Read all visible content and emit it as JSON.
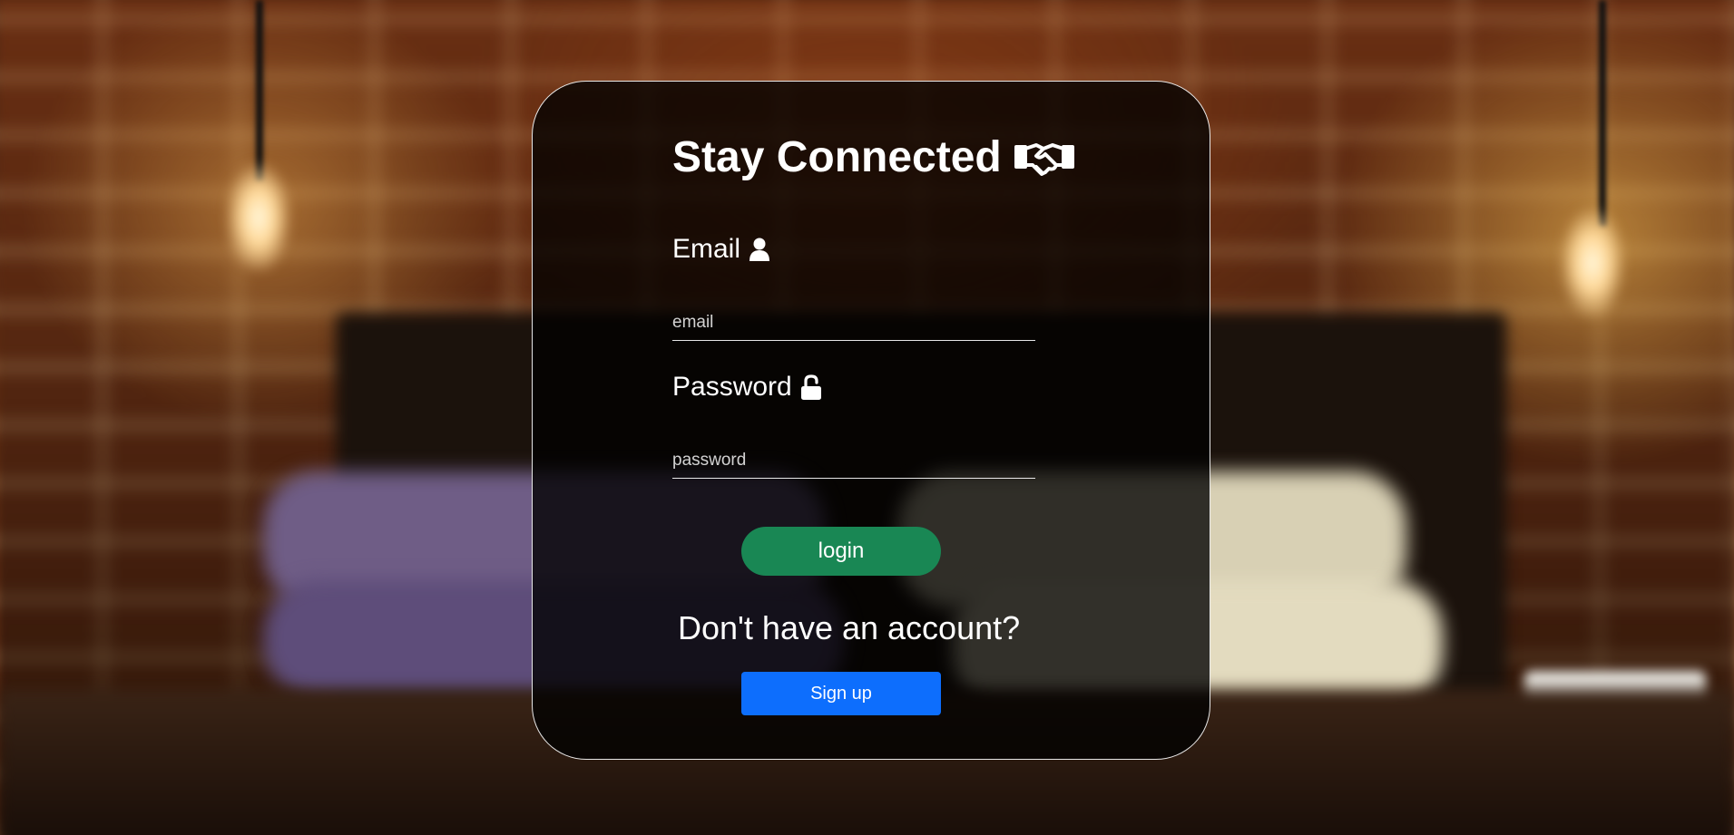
{
  "login_form": {
    "title": "Stay Connected",
    "title_icon": "handshake-icon",
    "email_label": "Email",
    "email_icon": "user-icon",
    "email_placeholder": "email",
    "email_value": "",
    "password_label": "Password",
    "password_icon": "unlock-icon",
    "password_placeholder": "password",
    "password_value": "",
    "login_button": "login",
    "no_account_text": "Don't have an account?",
    "signup_button": "Sign up"
  },
  "colors": {
    "login_button": "#198754",
    "signup_button": "#0d6efd",
    "card_background": "rgba(0,0,0,0.78)",
    "text": "#ffffff"
  }
}
